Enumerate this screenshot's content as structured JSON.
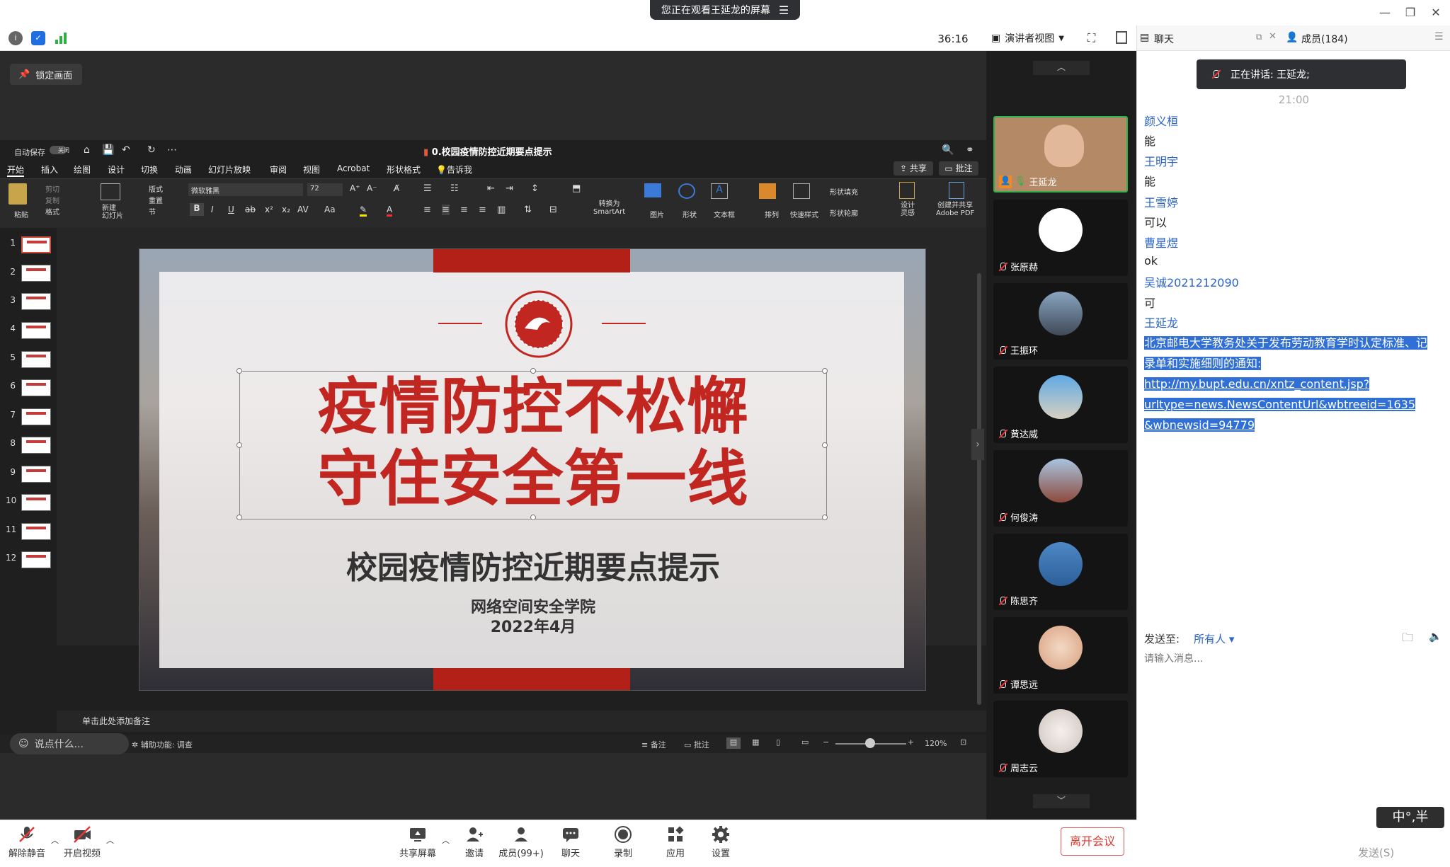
{
  "window": {
    "viewing_banner": "您正在观看王延龙的屏幕"
  },
  "toolbar": {
    "timer": "36:16",
    "view_mode": "演讲者视图"
  },
  "right_header": {
    "chat_tab": "聊天",
    "members_tab": "成员(184)"
  },
  "screen": {
    "lock_label": "锁定画面"
  },
  "ppt": {
    "autosave": "自动保存",
    "autosave_state": "关闭",
    "doc_title": "0.校园疫情防控近期要点提示",
    "tabs": [
      "开始",
      "插入",
      "绘图",
      "设计",
      "切换",
      "动画",
      "幻灯片放映",
      "审阅",
      "视图",
      "Acrobat",
      "形状格式",
      "告诉我"
    ],
    "share_label": "共享",
    "comment_label": "批注",
    "ribbon": {
      "paste": "粘贴",
      "cut": "剪切",
      "copy": "复制",
      "format": "格式",
      "new_slide": "新建\n幻灯片",
      "layout": "版式",
      "reset": "重置",
      "section": "节",
      "font": "微软雅黑",
      "font_size": "72",
      "smartart": "转换为\nSmartArt",
      "picture": "图片",
      "shape": "形状",
      "textbox": "文本框",
      "arrange": "排列",
      "quick_styles": "快速样式",
      "shape_fill": "形状填充",
      "shape_outline": "形状轮廓",
      "designer": "设计\n灵感",
      "adobe": "创建并共享\nAdobe PDF"
    },
    "slide_numbers": [
      "1",
      "2",
      "3",
      "4",
      "5",
      "6",
      "7",
      "8",
      "9",
      "10",
      "11",
      "12"
    ],
    "slide": {
      "title_line1": "疫情防控不松懈",
      "title_line2": "守住安全第一线",
      "subtitle": "校园疫情防控近期要点提示",
      "org": "网络空间安全学院",
      "date": "2022年4月"
    },
    "notes_placeholder": "单击此处添加备注",
    "status": {
      "accessibility": "辅助功能: 调查",
      "notes": "备注",
      "comments": "批注",
      "zoom": "120%"
    },
    "ime_float": "说点什么..."
  },
  "participants": [
    {
      "name": "王延龙",
      "speaking": true
    },
    {
      "name": "张原赫"
    },
    {
      "name": "王振环"
    },
    {
      "name": "黄达威"
    },
    {
      "name": "何俊涛"
    },
    {
      "name": "陈思齐"
    },
    {
      "name": "谭思远"
    },
    {
      "name": "周志云"
    }
  ],
  "chat": {
    "speaking_label": "正在讲话: 王延龙;",
    "time": "21:00",
    "messages": [
      {
        "sender": "颜义桓",
        "text": "能"
      },
      {
        "sender": "王明宇",
        "text": "能"
      },
      {
        "sender": "王雪婷",
        "text": "可以"
      },
      {
        "sender": "曹星煜",
        "text": "ok"
      },
      {
        "sender": "吴诚2021212090",
        "text": "可"
      },
      {
        "sender": "王延龙",
        "text": ""
      }
    ],
    "highlight_lines": [
      "北京邮电大学教务处关于发布劳动教育学时认定标准、记",
      "录单和实施细则的通知:",
      "http://my.bupt.edu.cn/xntz_content.jsp?",
      "urltype=news.NewsContentUrl&wbtreeid=1635",
      "&wbnewsid=94779"
    ],
    "send_to_label": "发送至:",
    "send_to_value": "所有人",
    "input_placeholder": "请输入消息...",
    "ime_badge": "中°,半",
    "send_button": "发送(S)"
  },
  "bottom": {
    "unmute": "解除静音",
    "video": "开启视频",
    "share": "共享屏幕",
    "invite": "邀请",
    "members": "成员(99+)",
    "chat": "聊天",
    "record": "录制",
    "apps": "应用",
    "settings": "设置",
    "leave": "离开会议"
  },
  "colors": {
    "accent_blue": "#2a63c9",
    "slide_red": "#c12621",
    "highlight": "#2f6fd6",
    "leave_red": "#e0392e"
  }
}
